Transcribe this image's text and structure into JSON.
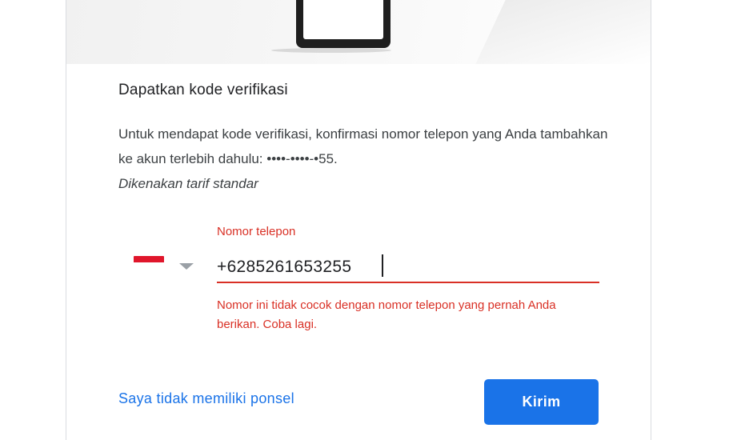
{
  "header": {
    "illustration_icon": "phone-illustration-icon"
  },
  "form": {
    "title": "Dapatkan kode verifikasi",
    "description_main": "Untuk mendapat kode verifikasi, konfirmasi nomor telepon yang Anda tambahkan ke akun terlebih dahulu: ",
    "masked_number": "••••-••••-•55",
    "description_end": ".",
    "rate_note": "Dikenakan tarif standar",
    "country": {
      "flag_icon": "indonesia-flag-icon",
      "dropdown_icon": "chevron-down-icon"
    },
    "phone_label": "Nomor telepon",
    "phone_value": "+6285261653255",
    "error_message": "Nomor ini tidak cocok dengan nomor telepon yang pernah Anda berikan. Coba lagi."
  },
  "actions": {
    "no_phone_link": "Saya tidak memiliki ponsel",
    "send_button": "Kirim"
  },
  "colors": {
    "error": "#d93025",
    "accent": "#1a73e8",
    "text": "#202124"
  }
}
